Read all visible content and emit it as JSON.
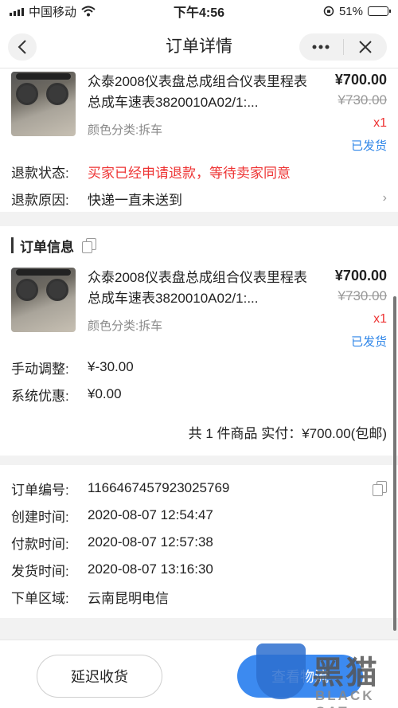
{
  "status_bar": {
    "carrier": "中国移动",
    "time": "下午4:56",
    "battery": "51%",
    "battery_level": 0.51
  },
  "nav": {
    "title": "订单详情",
    "back_icon": "chevron-left-icon",
    "more_icon": "more-dots-icon",
    "close_icon": "close-icon"
  },
  "refund_product": {
    "title": "众泰2008仪表盘总成组合仪表里程表总成车速表3820010A02/1:...",
    "variant": "颜色分类:拆车",
    "price": "¥700.00",
    "original_price": "¥730.00",
    "quantity": "x1",
    "ship_status": "已发货"
  },
  "refund": {
    "status_label": "退款状态:",
    "status_value": "买家已经申请退款，等待卖家同意",
    "reason_label": "退款原因:",
    "reason_value": "快递一直未送到"
  },
  "order_info": {
    "heading": "订单信息",
    "product": {
      "title": "众泰2008仪表盘总成组合仪表里程表总成车速表3820010A02/1:...",
      "variant": "颜色分类:拆车",
      "price": "¥700.00",
      "original_price": "¥730.00",
      "quantity": "x1",
      "ship_status": "已发货"
    },
    "adjust_label": "手动调整:",
    "adjust_value": "¥-30.00",
    "discount_label": "系统优惠:",
    "discount_value": "¥0.00",
    "summary": "共 1 件商品 实付：¥700.00(包邮)"
  },
  "order_meta": [
    {
      "label": "订单编号:",
      "value": "1166467457923025769"
    },
    {
      "label": "创建时间:",
      "value": "2020-08-07 12:54:47"
    },
    {
      "label": "付款时间:",
      "value": "2020-08-07 12:57:38"
    },
    {
      "label": "发货时间:",
      "value": "2020-08-07 13:16:30"
    },
    {
      "label": "下单区域:",
      "value": "云南昆明电信"
    }
  ],
  "actions": {
    "delay_label": "延迟收货",
    "logistics_label": "查看物流"
  },
  "watermark": {
    "text": "黑猫",
    "sub": "BLACK CAT"
  },
  "colors": {
    "accent": "#3c8af0",
    "warning": "#e33333",
    "link": "#2f86e8"
  }
}
